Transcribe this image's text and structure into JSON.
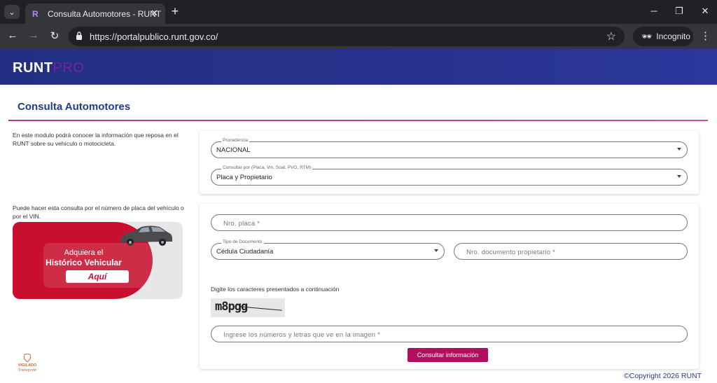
{
  "browser": {
    "tab_title": "Consulta Automotores - RUNT",
    "url": "https://portalpublico.runt.gov.co/",
    "incognito_label": "Incognito"
  },
  "header": {
    "logo_main": "RUNT",
    "logo_suffix": "PRO"
  },
  "page": {
    "title": "Consulta Automotores",
    "info_text_1": "En este modulo podrá conocer la información que reposa en el RUNT sobre su vehículo o motocicleta.",
    "info_text_2": "Puede hacer esta consulta por el número de placa del vehículo o por el VIN.",
    "copyright": "©Copyright 2026 RUNT",
    "vigilado_line1": "VIGILADO",
    "vigilado_line2": "Transporte"
  },
  "promo": {
    "line1": "Adquiera el",
    "line2": "Histórico Vehicular",
    "button": "Aquí"
  },
  "form": {
    "procedencia_label": "Procedencia",
    "procedencia_value": "NACIONAL",
    "consultar_label": "Consultar por (Placa, Vin, Soat, PVO, RTM)",
    "consultar_value": "Placa y Propietario",
    "placa_placeholder": "Nro. placa *",
    "tipo_doc_label": "Tipo de Documento",
    "tipo_doc_value": "Cédula Ciudadanía",
    "documento_placeholder": "Nro. documento propietario  *",
    "captcha_instruction": "Digite los caracteres presentados a continuación",
    "captcha_text": "m8pgg",
    "captcha_placeholder": "Ingrese los números y letras que ve en la imagen *",
    "submit_label": "Consultar información"
  },
  "colors": {
    "header_bg": "#28338e",
    "accent": "#b0115f",
    "title": "#243b8c",
    "promo_red": "#c8102e"
  }
}
